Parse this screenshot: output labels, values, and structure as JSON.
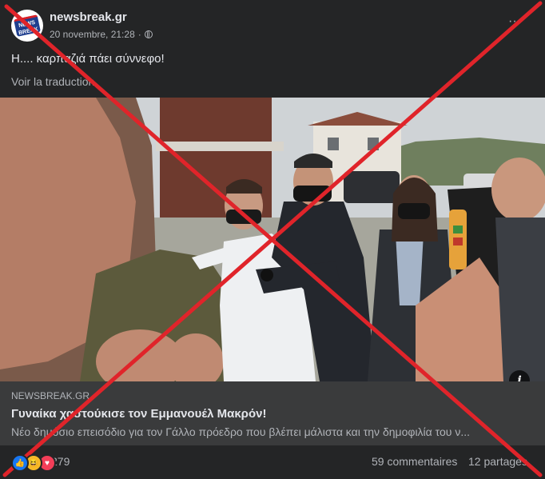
{
  "post": {
    "page_name": "newsbreak.gr",
    "timestamp": "20 novembre, 21:28",
    "visibility_icon": "globe-icon",
    "caption": "Η.... καρπαζιά πάει σύννεφο!",
    "see_translation": "Voir la traduction"
  },
  "avatar": {
    "logo_text": "NEWS BREAK"
  },
  "media": {
    "info_label": "i"
  },
  "link_preview": {
    "domain": "NEWSBREAK.GR",
    "title": "Γυναίκα χαστούκισε τον Εμμανουέλ Μακρόν!",
    "description": "Νέο δημόσιο επεισόδιο για τον Γάλλο πρόεδρο που βλέπει μάλιστα και την δημοφιλία του ν..."
  },
  "footer": {
    "reaction_icons": [
      "like-icon",
      "haha-icon",
      "love-icon"
    ],
    "reaction_count": "279",
    "comments": "59 commentaires",
    "shares": "12 partages"
  },
  "colors": {
    "background": "#242526",
    "link_preview_bg": "#3a3b3c",
    "overlay_cross": "#e0242a"
  }
}
